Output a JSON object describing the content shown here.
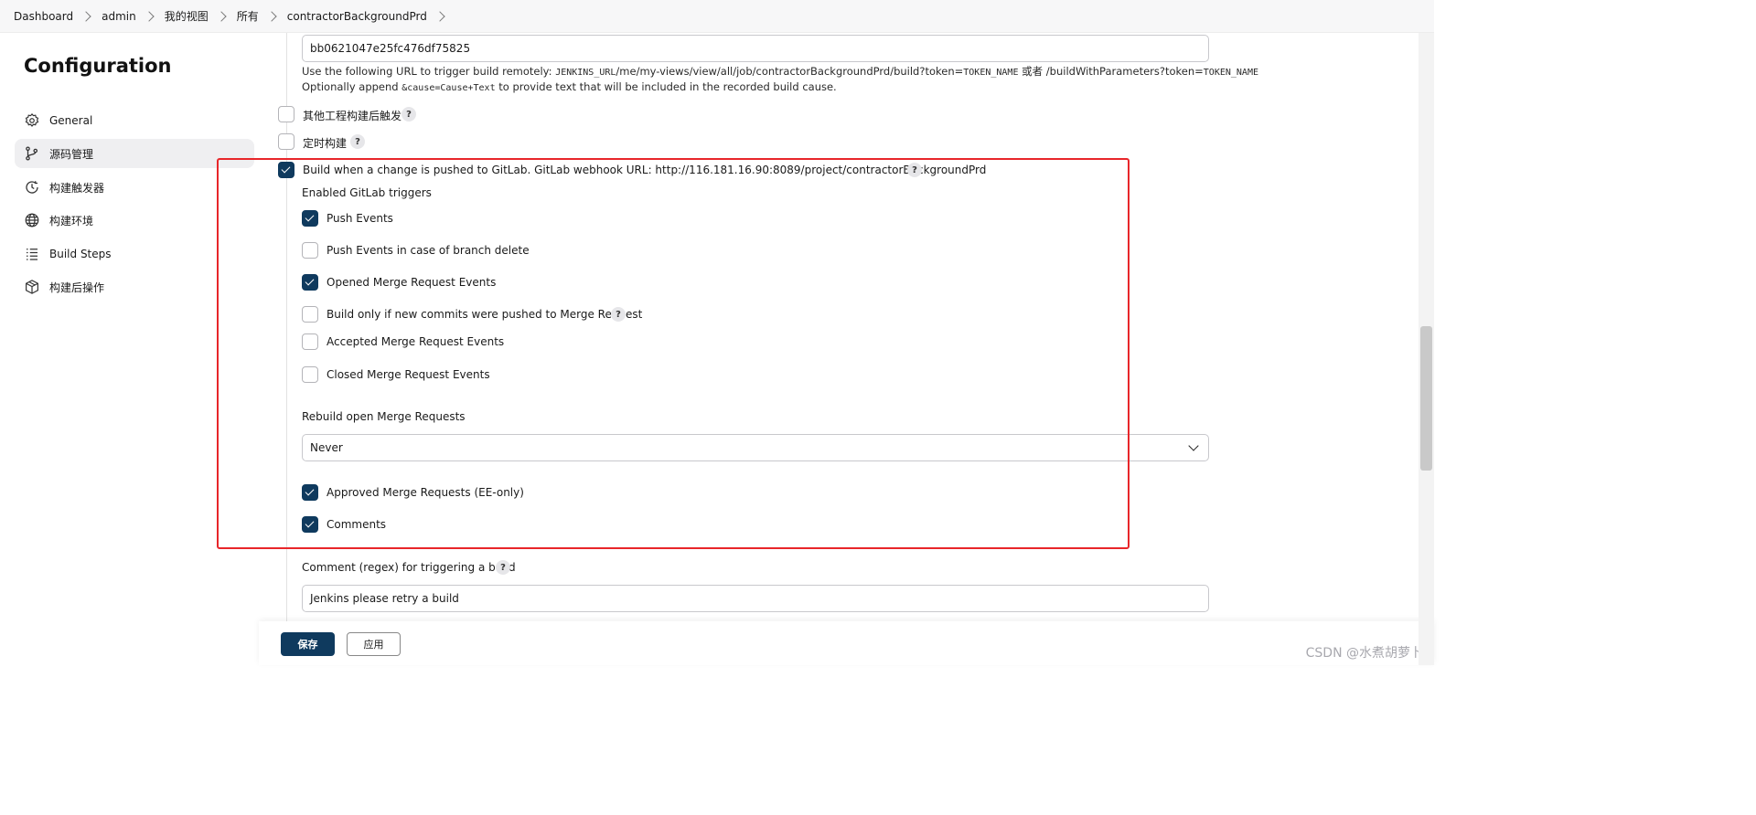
{
  "breadcrumb": [
    "Dashboard",
    "admin",
    "我的视图",
    "所有",
    "contractorBackgroundPrd"
  ],
  "sidebar": {
    "title": "Configuration",
    "items": [
      {
        "label": "General",
        "icon": "gear-icon"
      },
      {
        "label": "源码管理",
        "icon": "branch-icon",
        "active": true
      },
      {
        "label": "构建触发器",
        "icon": "clock-icon"
      },
      {
        "label": "构建环境",
        "icon": "globe-icon"
      },
      {
        "label": "Build Steps",
        "icon": "list-icon"
      },
      {
        "label": "构建后操作",
        "icon": "package-icon"
      }
    ]
  },
  "main": {
    "token_value": "bb0621047e25fc476df75825",
    "url_help": {
      "prefix": "Use the following URL to trigger build remotely: ",
      "jenkins_url": "JENKINS_URL",
      "path": "/me/my-views/view/all/job/contractorBackgroundPrd/build?token=",
      "token_name": "TOKEN_NAME",
      "or": " 或者 ",
      "alt_path": "/buildWithParameters?token=",
      "token_name2": "TOKEN_NAME"
    },
    "cause_help": {
      "prefix": "Optionally append ",
      "code": "&cause=Cause+Text",
      "suffix": " to provide text that will be included in the recorded build cause."
    },
    "trigger_other": {
      "label": "其他工程构建后触发",
      "checked": false
    },
    "trigger_schedule": {
      "label": "定时构建",
      "checked": false
    },
    "trigger_gitlab": {
      "label": "Build when a change is pushed to GitLab. GitLab webhook URL: http://116.181.16.90:8089/project/contractorBackgroundPrd",
      "checked": true
    },
    "gitlab_triggers_label": "Enabled GitLab triggers",
    "gitlab_triggers": [
      {
        "label": "Push Events",
        "checked": true
      },
      {
        "label": "Push Events in case of branch delete",
        "checked": false
      },
      {
        "label": "Opened Merge Request Events",
        "checked": true
      },
      {
        "label": "Build only if new commits were pushed to Merge Request",
        "checked": false,
        "help": true
      },
      {
        "label": "Accepted Merge Request Events",
        "checked": false
      },
      {
        "label": "Closed Merge Request Events",
        "checked": false
      }
    ],
    "rebuild_label": "Rebuild open Merge Requests",
    "rebuild_value": "Never",
    "approved_mr": {
      "label": "Approved Merge Requests (EE-only)",
      "checked": true
    },
    "comments": {
      "label": "Comments",
      "checked": true
    },
    "comment_regex_label": "Comment (regex) for triggering a build",
    "comment_regex_value": "Jenkins please retry a build",
    "help_glyph": "?"
  },
  "footer": {
    "save_label": "保存",
    "apply_label": "应用"
  },
  "watermark": "CSDN @水煮胡萝卜",
  "colors": {
    "primary": "#0f3a5e",
    "highlight": "#e8262a",
    "active_bg": "#efeff1"
  }
}
